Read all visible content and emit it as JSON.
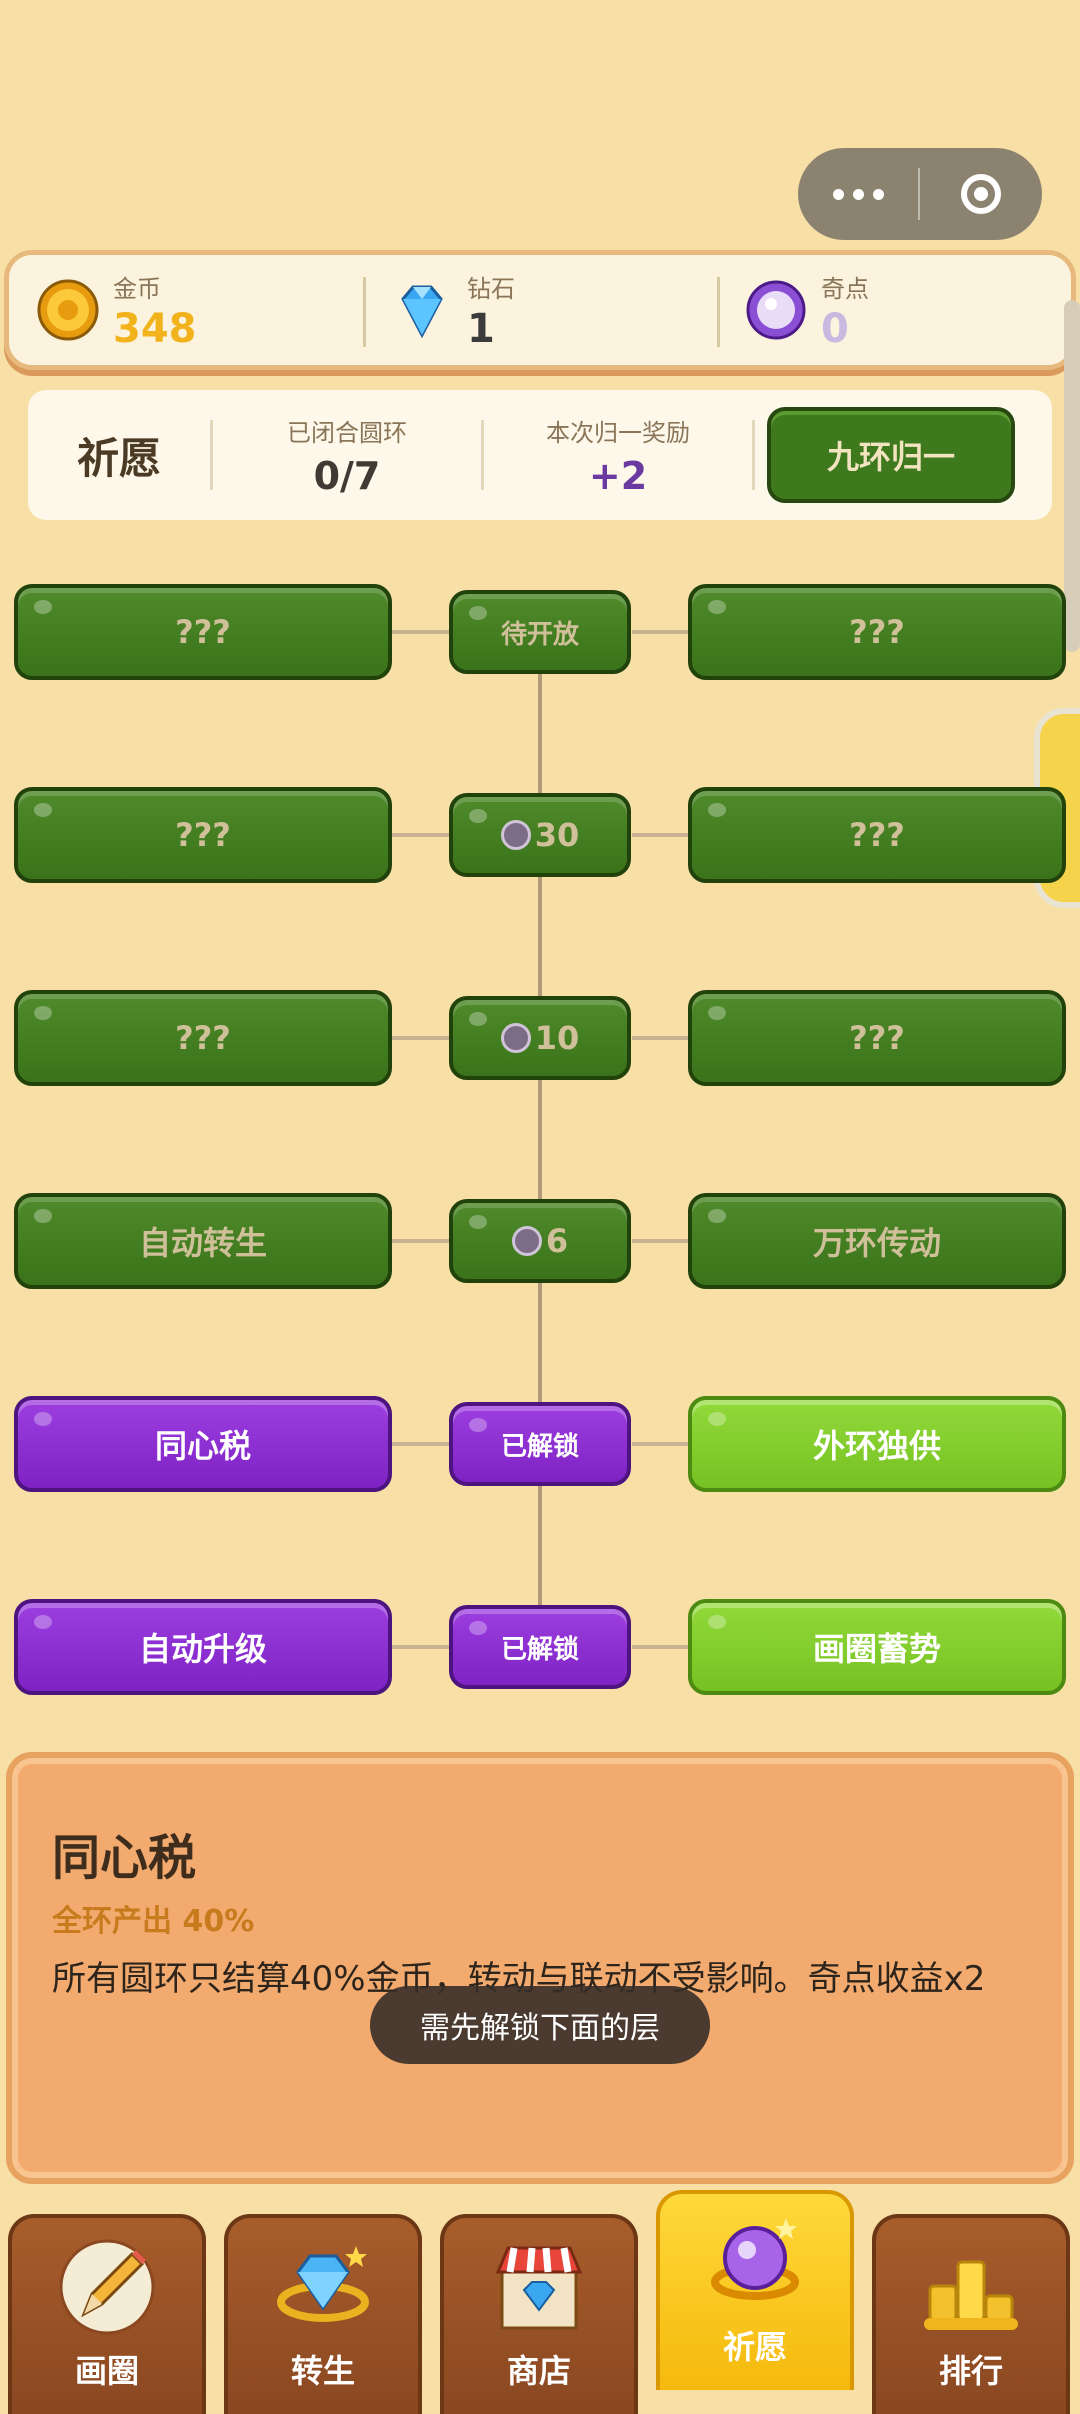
{
  "capsule": {
    "more_icon": "more-dots-icon",
    "close_icon": "target-circle-icon"
  },
  "currency": [
    {
      "label": "金币",
      "value": "348",
      "icon": "gold-coin-icon",
      "color": "#f2b21c"
    },
    {
      "label": "钻石",
      "value": "1",
      "icon": "diamond-icon",
      "color": "#3aa8f0"
    },
    {
      "label": "奇点",
      "value": "0",
      "icon": "purple-orb-icon",
      "color": "#8b4fd6"
    }
  ],
  "pray": {
    "title": "祈愿",
    "closed_rings_label": "已闭合圆环",
    "closed_rings_value": "0/7",
    "reward_label": "本次归一奖励",
    "reward_value": "+2",
    "button": "九环归一"
  },
  "tree": {
    "rows": [
      {
        "left": "???",
        "mid": "待开放",
        "mid_cost": "",
        "right": "???",
        "state": "locked"
      },
      {
        "left": "???",
        "mid": "30",
        "mid_cost": "orb",
        "right": "???",
        "state": "locked"
      },
      {
        "left": "???",
        "mid": "10",
        "mid_cost": "orb",
        "right": "???",
        "state": "locked"
      },
      {
        "left": "自动转生",
        "mid": "6",
        "mid_cost": "orb",
        "right": "万环传动",
        "state": "locked"
      },
      {
        "left": "同心税",
        "mid": "已解锁",
        "mid_cost": "",
        "right": "外环独供",
        "state": "unlocked"
      },
      {
        "left": "自动升级",
        "mid": "已解锁",
        "mid_cost": "",
        "right": "画圈蓄势",
        "state": "unlocked"
      }
    ]
  },
  "detail": {
    "title": "同心税",
    "subtitle": "全环产出 40%",
    "description": "所有圆环只结算40%金币，转动与联动不受影响。奇点收益x2"
  },
  "toast": "需先解锁下面的层",
  "tabs": [
    {
      "label": "画圈",
      "icon": "pencil-icon",
      "active": false
    },
    {
      "label": "转生",
      "icon": "diamond-ring-icon",
      "active": false
    },
    {
      "label": "商店",
      "icon": "shop-icon",
      "active": false
    },
    {
      "label": "祈愿",
      "icon": "crystal-orb-icon",
      "active": true
    },
    {
      "label": "排行",
      "icon": "podium-icon",
      "active": false
    }
  ]
}
